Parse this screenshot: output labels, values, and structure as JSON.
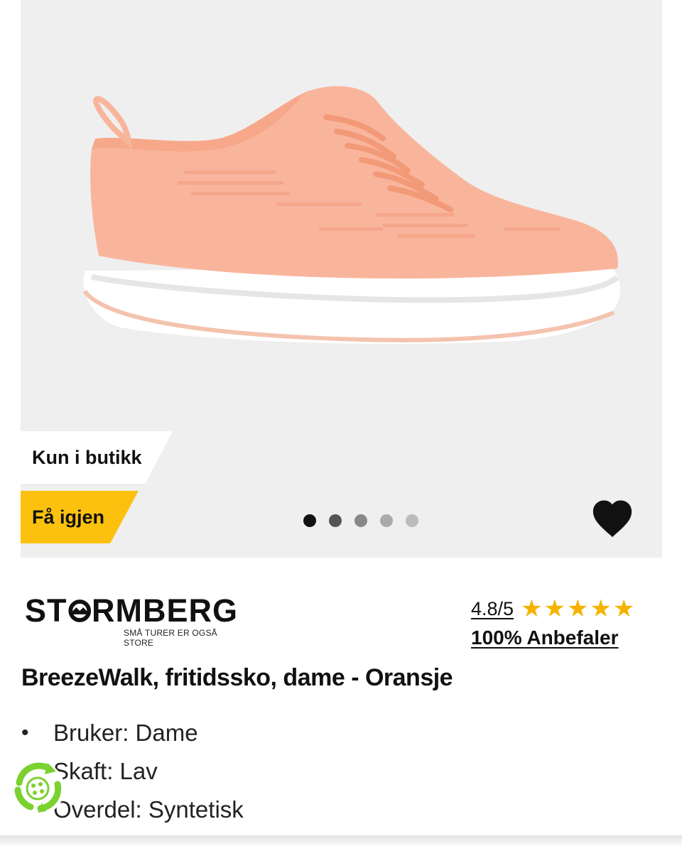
{
  "product_image": {
    "alt": "BreezeWalk fritidssko dame oransje",
    "badges": {
      "store_only": "Kun i butikk",
      "restock": "Få igjen"
    },
    "carousel": {
      "count": 5,
      "active_index": 0
    }
  },
  "brand": {
    "name_part1": "ST",
    "name_part2": "RMBERG",
    "tagline": "SMÅ TURER ER OGSÅ STORE"
  },
  "rating": {
    "score": "4.8/5",
    "stars": 5,
    "recommend": "100% Anbefaler"
  },
  "product": {
    "title": "BreezeWalk, fritidssko, dame - Oransje"
  },
  "specs": [
    {
      "text": "Bruker: Dame"
    },
    {
      "text": "Skaft: Lav"
    },
    {
      "text": "Overdel: Syntetisk"
    }
  ],
  "colors": {
    "accent": "#fcc10f",
    "star": "#f5b300",
    "shoe": "#f9b59c",
    "eco": "#7bd12f"
  }
}
